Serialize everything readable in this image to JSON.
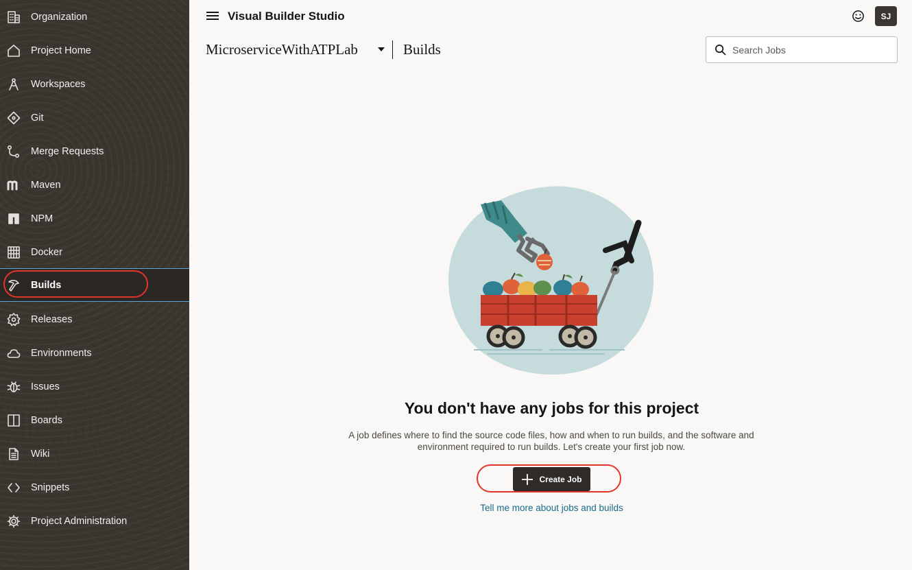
{
  "sidebar": {
    "items": [
      {
        "label": "Organization",
        "icon": "building-icon"
      },
      {
        "label": "Project Home",
        "icon": "home-icon"
      },
      {
        "label": "Workspaces",
        "icon": "compass-icon"
      },
      {
        "label": "Git",
        "icon": "git-icon"
      },
      {
        "label": "Merge Requests",
        "icon": "merge-request-icon"
      },
      {
        "label": "Maven",
        "icon": "maven-icon"
      },
      {
        "label": "NPM",
        "icon": "npm-icon"
      },
      {
        "label": "Docker",
        "icon": "docker-icon"
      },
      {
        "label": "Builds",
        "icon": "hammer-icon",
        "active": true
      },
      {
        "label": "Releases",
        "icon": "badge-icon"
      },
      {
        "label": "Environments",
        "icon": "cloud-icon"
      },
      {
        "label": "Issues",
        "icon": "bug-icon"
      },
      {
        "label": "Boards",
        "icon": "board-icon"
      },
      {
        "label": "Wiki",
        "icon": "document-icon"
      },
      {
        "label": "Snippets",
        "icon": "code-icon"
      },
      {
        "label": "Project Administration",
        "icon": "gear-icon"
      }
    ]
  },
  "header": {
    "app_title": "Visual Builder Studio",
    "avatar_initials": "SJ",
    "project_name": "MicroserviceWithATPLab",
    "page_title": "Builds"
  },
  "search": {
    "placeholder": "Search Jobs",
    "value": ""
  },
  "empty_state": {
    "title": "You don't have any jobs for this project",
    "description": "A job defines where to find the source code files, how and when to run builds, and the software and environment required to run builds. Let's create your first job now.",
    "create_button_label": "Create Job",
    "learn_more_link": "Tell me more about jobs and builds"
  },
  "colors": {
    "sidebar_bg": "#3b3530",
    "active_highlight_border": "#5aa8d6",
    "annotation_red": "#e3342a",
    "primary_button": "#2f2b28",
    "link": "#176a8b"
  }
}
